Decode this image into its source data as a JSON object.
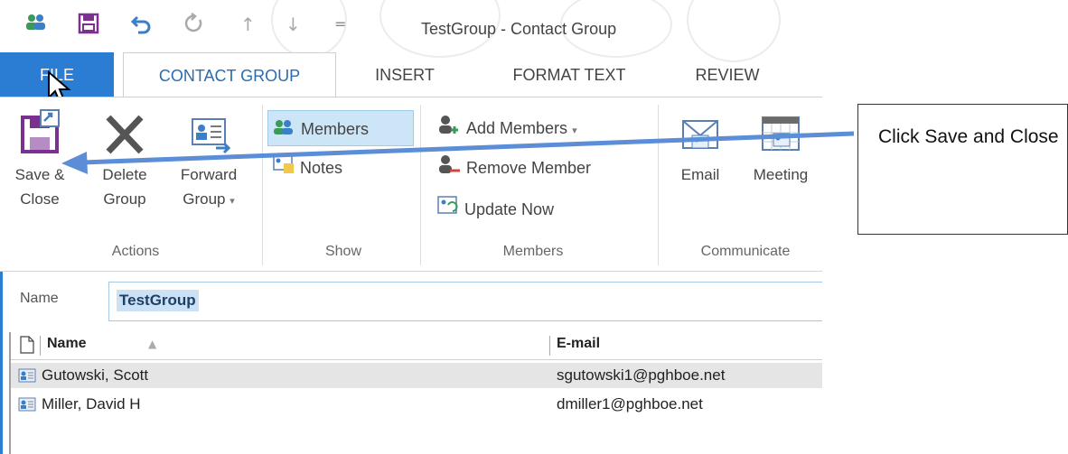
{
  "window": {
    "title": "TestGroup - Contact Group",
    "qat_icons": [
      "contact-group-icon",
      "save-icon",
      "undo-icon",
      "redo-icon",
      "up-arrow-icon",
      "down-arrow-icon",
      "customize-qat-icon"
    ]
  },
  "tabs": {
    "file": "FILE",
    "contact_group": "CONTACT GROUP",
    "insert": "INSERT",
    "format_text": "FORMAT TEXT",
    "review": "REVIEW"
  },
  "ribbon": {
    "actions": {
      "save_close_line1": "Save &",
      "save_close_line2": "Close",
      "delete_line1": "Delete",
      "delete_line2": "Group",
      "forward_line1": "Forward",
      "forward_line2": "Group",
      "group_label": "Actions"
    },
    "show": {
      "members": "Members",
      "notes": "Notes",
      "group_label": "Show"
    },
    "members": {
      "add": "Add Members",
      "remove": "Remove Member",
      "update": "Update Now",
      "group_label": "Members"
    },
    "communicate": {
      "email": "Email",
      "meeting": "Meeting",
      "group_label": "Communicate"
    }
  },
  "name_field": {
    "label": "Name",
    "value": "TestGroup"
  },
  "member_list": {
    "columns": [
      "Name",
      "E-mail"
    ],
    "rows": [
      {
        "name": "Gutowski, Scott",
        "email": "sgutowski1@pghboe.net"
      },
      {
        "name": "Miller, David H",
        "email": "dmiller1@pghboe.net"
      }
    ]
  },
  "callout": {
    "text": "Click Save and Close"
  },
  "colors": {
    "accent": "#2b7cd3",
    "selection": "#cde6f7",
    "arrow": "#5b8ed6"
  }
}
